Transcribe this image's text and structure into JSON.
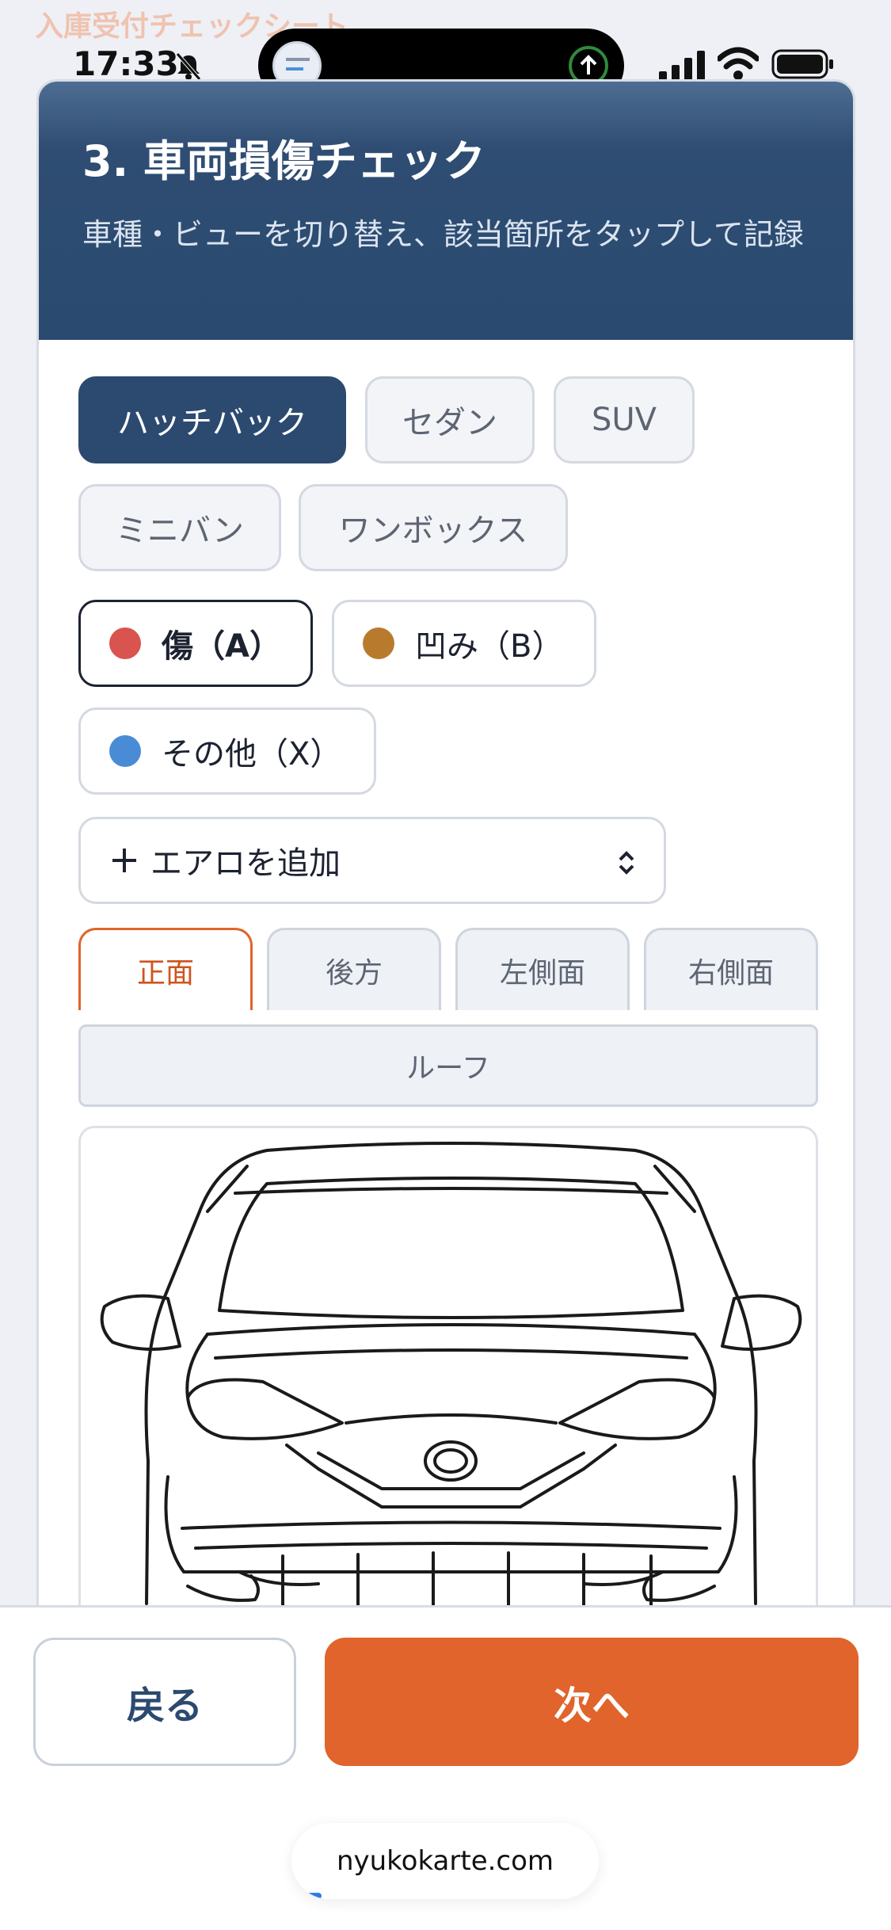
{
  "page_behind_title": "入庫受付チェックシート",
  "status_bar": {
    "time": "17:33"
  },
  "header": {
    "title": "3. 車両損傷チェック",
    "subtitle": "車種・ビューを切り替え、該当箇所をタップして記録"
  },
  "vehicle_types": [
    {
      "label": "ハッチバック",
      "selected": true
    },
    {
      "label": "セダン",
      "selected": false
    },
    {
      "label": "SUV",
      "selected": false
    },
    {
      "label": "ミニバン",
      "selected": false
    },
    {
      "label": "ワンボックス",
      "selected": false
    }
  ],
  "damage_types": [
    {
      "label": "傷（A）",
      "color": "#d9534f",
      "selected": true
    },
    {
      "label": "凹み（B）",
      "color": "#b87b2e",
      "selected": false
    },
    {
      "label": "その他（X）",
      "color": "#4a8bd6",
      "selected": false
    }
  ],
  "aero_select": {
    "label": "エアロを追加"
  },
  "view_tabs": [
    {
      "label": "正面",
      "active": true
    },
    {
      "label": "後方",
      "active": false
    },
    {
      "label": "左側面",
      "active": false
    },
    {
      "label": "右側面",
      "active": false
    },
    {
      "label": "ルーフ",
      "active": false
    }
  ],
  "footer": {
    "back_label": "戻る",
    "next_label": "次へ"
  },
  "browser": {
    "url": "nyukokarte.com"
  },
  "colors": {
    "header": "#2c4a70",
    "accent": "#e0642b"
  }
}
